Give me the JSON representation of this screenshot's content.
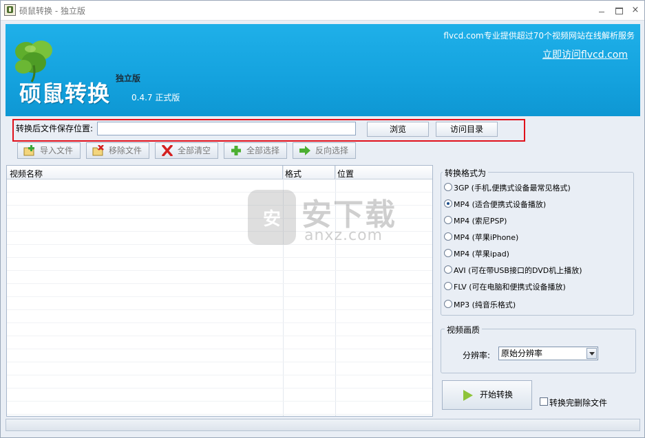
{
  "window": {
    "title": "硕鼠转换 - 独立版",
    "minimize_icon": "minimize-icon",
    "maximize_icon": "maximize-icon",
    "close_label": "×"
  },
  "banner": {
    "app_name": "硕鼠转换",
    "edition": "独立版",
    "version": "0.4.7 正式版",
    "tagline": "flvcd.com专业提供超过70个视频网站在线解析服务",
    "visit_link": "立即访问flvcd.com",
    "background_color": "#16a5e0"
  },
  "save_path": {
    "label": "转换后文件保存位置:",
    "value": "",
    "browse_label": "浏览",
    "open_dir_label": "访问目录"
  },
  "toolbar": {
    "import_label": "导入文件",
    "remove_label": "移除文件",
    "clear_label": "全部清空",
    "select_all_label": "全部选择",
    "invert_label": "反向选择"
  },
  "table": {
    "columns": [
      "视频名称",
      "格式",
      "位置"
    ],
    "rows": []
  },
  "watermark": {
    "cn": "安下载",
    "en": "anxz.com"
  },
  "format": {
    "title": "转换格式为",
    "options": [
      {
        "label": "3GP (手机,便携式设备最常见格式)",
        "checked": false
      },
      {
        "label": "MP4 (适合便携式设备播放)",
        "checked": true
      },
      {
        "label": "MP4 (索尼PSP)",
        "checked": false
      },
      {
        "label": "MP4 (苹果iPhone)",
        "checked": false
      },
      {
        "label": "MP4 (苹果ipad)",
        "checked": false
      },
      {
        "label": "AVI (可在带USB接口的DVD机上播放)",
        "checked": false
      },
      {
        "label": "FLV (可在电脑和便携式设备播放)",
        "checked": false
      },
      {
        "label": "MP3 (纯音乐格式)",
        "checked": false
      }
    ]
  },
  "quality": {
    "title": "视频画质",
    "resolution_label": "分辨率:",
    "resolution_value": "原始分辨率"
  },
  "actions": {
    "start_label": "开始转换",
    "delete_after_label": "转换完删除文件",
    "delete_after_checked": false
  },
  "colors": {
    "highlight_border": "#e0101a",
    "start_arrow": "#8ec43a"
  }
}
